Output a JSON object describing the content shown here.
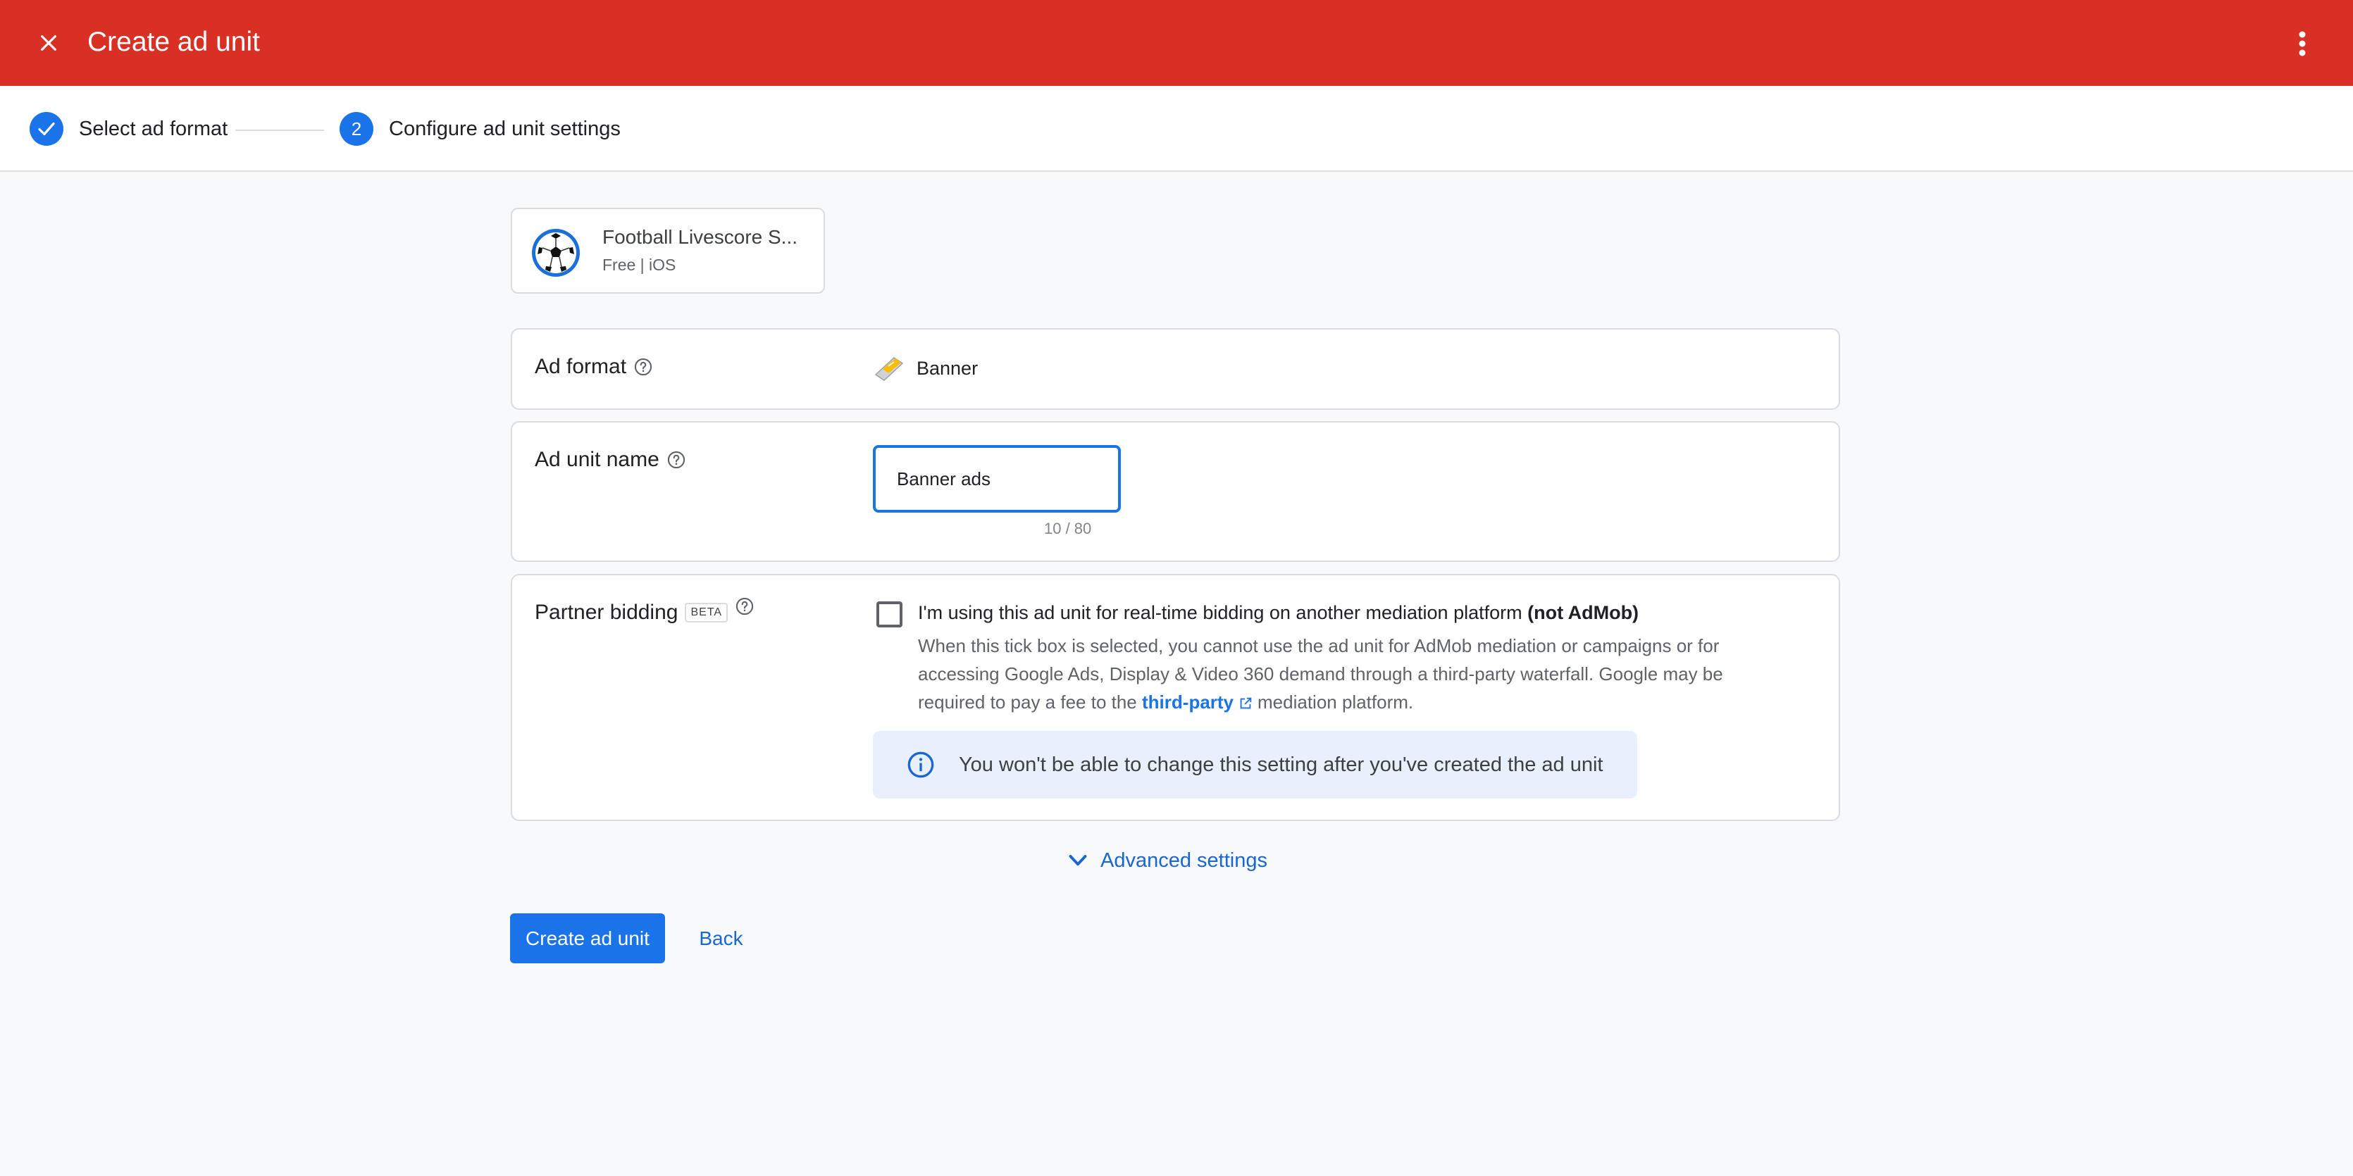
{
  "header": {
    "title": "Create ad unit",
    "close_icon": "close-icon",
    "more_icon": "more-vert-icon",
    "color": "#d93025"
  },
  "stepper": {
    "steps": [
      {
        "label": "Select ad format",
        "state": "completed",
        "marker": "check-icon"
      },
      {
        "label": "Configure ad unit settings",
        "state": "active",
        "marker": "2"
      }
    ]
  },
  "app": {
    "name": "Football Livescore S...",
    "meta": "Free | iOS",
    "icon": "soccer-ball-icon"
  },
  "ad_format": {
    "label": "Ad format",
    "value": "Banner",
    "icon": "banner-format-icon"
  },
  "ad_unit_name": {
    "label": "Ad unit name",
    "value": "Banner ads",
    "char_count": "10 / 80"
  },
  "partner_bidding": {
    "label": "Partner bidding",
    "badge": "BETA",
    "checked": false,
    "checkbox_label": "I'm using this ad unit for real-time bidding on another mediation platform",
    "checkbox_label_bold": "(not AdMob)",
    "description_before_link": "When this tick box is selected, you cannot use the ad unit for AdMob mediation or campaigns or for accessing Google Ads, Display & Video 360 demand through a third-party waterfall. Google may be required to pay a fee to the",
    "link_text": "third-party",
    "description_after_link": "mediation platform.",
    "info_text": "You won't be able to change this setting after you've created the ad unit"
  },
  "advanced_settings": {
    "label": "Advanced settings"
  },
  "actions": {
    "primary_label": "Create ad unit",
    "secondary_label": "Back"
  },
  "colors": {
    "accent": "#1a73e8",
    "info_bg": "#e8f0fe",
    "page_bg": "#f8f9fa"
  }
}
